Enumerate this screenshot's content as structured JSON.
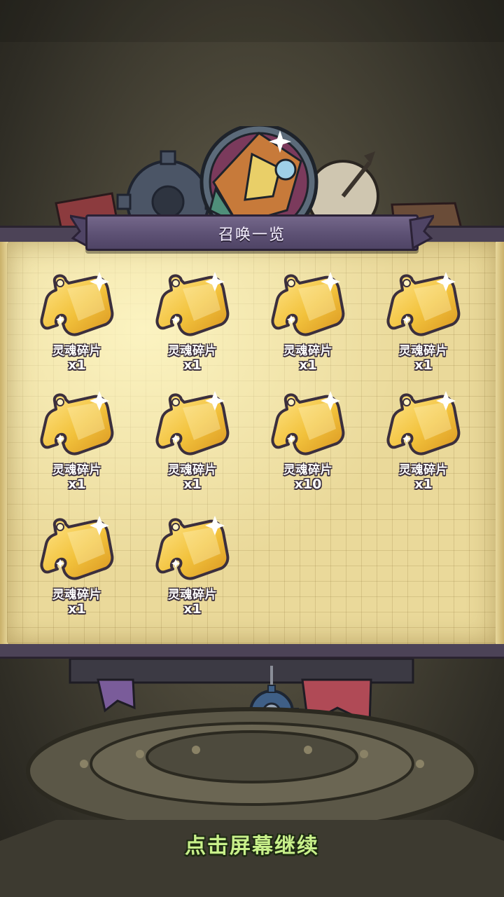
{
  "dialog": {
    "title": "召唤一览"
  },
  "items": [
    {
      "name": "灵魂碎片",
      "count": "x1"
    },
    {
      "name": "灵魂碎片",
      "count": "x1"
    },
    {
      "name": "灵魂碎片",
      "count": "x1"
    },
    {
      "name": "灵魂碎片",
      "count": "x1"
    },
    {
      "name": "灵魂碎片",
      "count": "x1"
    },
    {
      "name": "灵魂碎片",
      "count": "x1"
    },
    {
      "name": "灵魂碎片",
      "count": "x10"
    },
    {
      "name": "灵魂碎片",
      "count": "x1"
    },
    {
      "name": "灵魂碎片",
      "count": "x1"
    },
    {
      "name": "灵魂碎片",
      "count": "x1"
    }
  ],
  "item_icon": "soul-shard-puzzle-icon",
  "footer": {
    "continue_hint": "点击屏幕继续"
  },
  "colors": {
    "shard_gold": "#f2c23c",
    "panel_purple": "#5d5174",
    "hint_green": "#c8f08a"
  }
}
